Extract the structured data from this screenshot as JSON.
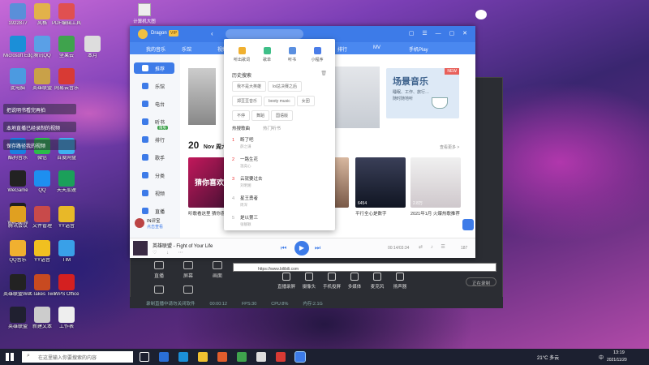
{
  "desktop": {
    "icons": [
      {
        "label": "1922877",
        "color": "#5a8fd9"
      },
      {
        "label": "风格",
        "color": "#e2b24a"
      },
      {
        "label": "PDF编辑工具",
        "color": "#e05050"
      },
      {
        "label": "Microsoft Edge",
        "color": "#1b8fd8"
      },
      {
        "label": "腾讯QQ",
        "color": "#5aa0e6"
      },
      {
        "label": "坚果云",
        "color": "#3fa34d"
      },
      {
        "label": "本月",
        "color": "#ddd"
      },
      {
        "label": "此电脑",
        "color": "#4c9ae0"
      },
      {
        "label": "英雄联盟",
        "color": "#c9a148"
      },
      {
        "label": "网易云音乐",
        "color": "#d83a34"
      },
      {
        "label": "WeGame",
        "color": "#222"
      },
      {
        "label": "QQ",
        "color": "#1d8ff0"
      },
      {
        "label": "天天加速",
        "color": "#1ba05a"
      },
      {
        "label": "WeGame",
        "color": "#1f1f1f"
      },
      {
        "label": "酷狗音乐",
        "color": "#1b7fe0"
      },
      {
        "label": "微信",
        "color": "#2bbd4a"
      },
      {
        "label": "百度网盘",
        "color": "#3fb0f0"
      },
      {
        "label": "腾讯会议",
        "color": "#e0a020"
      },
      {
        "label": "YY语音",
        "color": "#f0c020"
      },
      {
        "label": "TIM",
        "color": "#39a0e8"
      },
      {
        "label": "QQ音乐",
        "color": "#f0b030"
      },
      {
        "label": "YY语音",
        "color": "#e8b828"
      },
      {
        "label": "文件管理",
        "color": "#c84a4a"
      },
      {
        "label": "英雄联盟WeGame版",
        "color": "#222"
      },
      {
        "label": "It Takes Two",
        "color": "#c84a20"
      },
      {
        "label": "WPS Office",
        "color": "#d42020"
      },
      {
        "label": "英雄联盟",
        "color": "#202030"
      },
      {
        "label": "新建文本",
        "color": "#ccc"
      },
      {
        "label": "工作表",
        "color": "#eee"
      }
    ],
    "blur_texts": [
      "把说明书看完再拍",
      "本地直播已经录制的视频",
      "保存路径我的视频"
    ],
    "corner_label": "计算机大图"
  },
  "recorder": {
    "tabs": [
      "直播",
      "屏幕",
      "画面",
      "剪辑",
      "特效"
    ],
    "url_text": "https://www.bilibili.com",
    "buttons": [
      "直播录屏",
      "摄像头",
      "手机投屏",
      "多媒体",
      "麦克风",
      "扬声器",
      "设置",
      "结束直播"
    ],
    "footer": [
      "录制直播中请勿关闭软件",
      "00:00:12",
      "FPS:30",
      "CPU:8%",
      "内存:2.1G"
    ],
    "status_right": "正在录制"
  },
  "qq": {
    "user_name": "Dragon",
    "vip_label": "VIP",
    "top_tabs": [
      "我的音乐",
      "乐馆",
      "视频",
      "电台",
      "排行",
      "MV",
      "手机Play"
    ],
    "sidebar": [
      {
        "label": "推荐",
        "active": true
      },
      {
        "label": "乐馆",
        "active": false
      },
      {
        "label": "电台",
        "active": false
      },
      {
        "label": "听书",
        "active": false,
        "badge": "限免"
      },
      {
        "label": "排行",
        "active": false
      },
      {
        "label": "歌手",
        "active": false
      },
      {
        "label": "分类",
        "active": false
      },
      {
        "label": "视频",
        "active": false
      },
      {
        "label": "直播",
        "active": false
      }
    ],
    "user_bottom": {
      "name": "IN评宝",
      "sub": "点击查看"
    },
    "date_num": "20",
    "date_text": "Nov  周六",
    "more_label": "查看更多 >",
    "banner": {
      "title": "场景音乐",
      "sub": "睡眠、工作、旅行…",
      "sub2": "随时随地听",
      "new_badge": "NEW"
    },
    "cards": [
      {
        "title": "听歌看这里 猜你喜欢",
        "cover": "猜你喜欢"
      },
      {
        "title": "那的门"
      },
      {
        "title": "平行全心是数字"
      },
      {
        "title": "2021年1月 火爆热歌推荐"
      }
    ],
    "card_counts": [
      "45万",
      "6454",
      "2.8万"
    ],
    "player": {
      "song": "英雄联盟 - Fight of Your Life",
      "time": "00:14/03:34",
      "quality": "标准",
      "count": "187"
    }
  },
  "dropdown": {
    "shortcuts": [
      "听出歌词",
      "歌单",
      "听书",
      "小程序"
    ],
    "history_title": "历史搜索",
    "history": [
      "我不是大英雄",
      "lol总决赛之后",
      "郑豆豆音乐",
      "booty music",
      "女团",
      "不停",
      "舞蹈",
      "国语版"
    ],
    "hot_tabs": [
      "热搜歌曲",
      "热门听书"
    ],
    "hot": [
      {
        "title": "断了吧",
        "sub": "薛之谦"
      },
      {
        "title": "一路生花",
        "sub": "温奕心"
      },
      {
        "title": "云就要过去",
        "sub": "刘明湘"
      },
      {
        "title": "星王勇者",
        "sub": "周深"
      },
      {
        "title": "是以第三",
        "sub": "张靓颖"
      }
    ]
  },
  "taskbar": {
    "search_placeholder": "在这里输入你要搜索的内容",
    "weather": "21°C 多云",
    "ime": "中",
    "time": "13:19",
    "date": "2021/11/20"
  },
  "colors": {
    "qq_blue": "#3d7be8",
    "taskbar": "#1c2030",
    "recorder": "#2b2d33"
  }
}
